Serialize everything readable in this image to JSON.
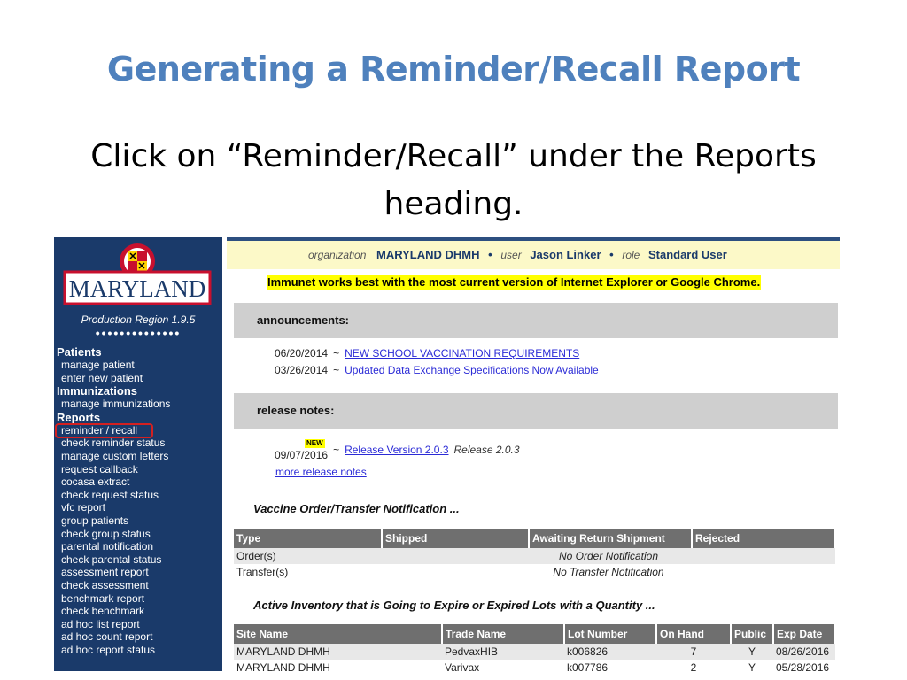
{
  "slide": {
    "title": "Generating a Reminder/Recall Report",
    "body": "Click on “Reminder/Recall” under the Reports heading."
  },
  "logo": {
    "state_name": "MARYLAND",
    "seal_icon": "maryland-flag-seal-icon"
  },
  "nav": {
    "region": "Production Region 1.9.5",
    "dots": "••••••••••••••",
    "sections": [
      {
        "heading": "Patients",
        "items": [
          "manage patient",
          "enter new patient"
        ]
      },
      {
        "heading": "Immunizations",
        "items": [
          "manage immunizations"
        ]
      },
      {
        "heading": "Reports",
        "items": [
          "reminder / recall",
          "check reminder status",
          "manage custom letters",
          "request callback",
          "cocasa extract",
          "check request status",
          "vfc report",
          "group patients",
          "check group status",
          "parental notification",
          "check parental status",
          "assessment report",
          "check assessment",
          "benchmark report",
          "check benchmark",
          "ad hoc list report",
          "ad hoc count report",
          "ad hoc report status"
        ]
      }
    ],
    "highlight_color": "#d42020"
  },
  "header": {
    "org_label": "organization",
    "org_value": "MARYLAND DHMH",
    "user_label": "user",
    "user_value": "Jason Linker",
    "role_label": "role",
    "role_value": "Standard User",
    "bullet": "•"
  },
  "warning": "Immunet works best with the most current version of Internet Explorer or Google Chrome.",
  "announcements": {
    "title": "announcements:",
    "items": [
      {
        "date": "06/20/2014",
        "sep": "~",
        "link": "NEW SCHOOL VACCINATION REQUIREMENTS"
      },
      {
        "date": "03/26/2014",
        "sep": "~",
        "link": "Updated Data Exchange Specifications Now Available"
      }
    ]
  },
  "release_notes": {
    "title": "release notes:",
    "badge": "NEW",
    "date": "09/07/2016",
    "sep": "~",
    "link": "Release Version 2.0.3",
    "extra": "Release 2.0.3",
    "more": "more release notes"
  },
  "vaccine_order": {
    "title": "Vaccine Order/Transfer Notification ...",
    "columns": [
      "Type",
      "Shipped",
      "Awaiting Return Shipment",
      "Rejected"
    ],
    "rows": [
      {
        "type": "Order(s)",
        "note": "No Order Notification"
      },
      {
        "type": "Transfer(s)",
        "note": "No Transfer Notification"
      }
    ]
  },
  "inventory": {
    "title": "Active Inventory that is Going to Expire or Expired Lots with a Quantity ...",
    "columns": [
      "Site Name",
      "Trade Name",
      "Lot Number",
      "On Hand",
      "Public",
      "Exp Date"
    ],
    "rows": [
      [
        "MARYLAND DHMH",
        "PedvaxHIB",
        "k006826",
        "7",
        "Y",
        "08/26/2016"
      ],
      [
        "MARYLAND DHMH",
        "Varivax",
        "k007786",
        "2",
        "Y",
        "05/28/2016"
      ]
    ]
  },
  "colors": {
    "title_blue": "#4f81bd",
    "nav_bg": "#1a3a6a",
    "link": "#2b2bd6",
    "info_bg": "#fcf9c8"
  }
}
